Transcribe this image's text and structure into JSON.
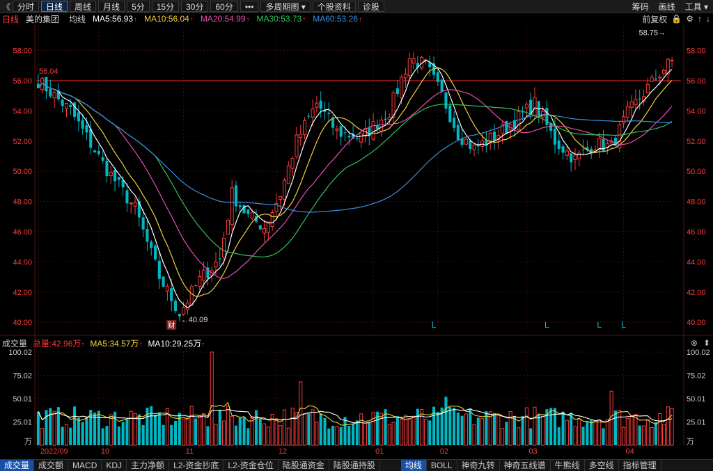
{
  "toolbar": {
    "back_icon": "《",
    "buttons": [
      "分时",
      "日线",
      "周线",
      "月线",
      "5分",
      "15分",
      "30分",
      "60分",
      "•••",
      "多周期图 ▾",
      "个股资料",
      "诊股"
    ],
    "active_index": 1,
    "right": [
      "筹码",
      "画线",
      "工具 ▾"
    ]
  },
  "legend": {
    "period": "日线",
    "stock": "美的集团",
    "ind": "均线",
    "ma5": "MA5:56.93",
    "ma10": "MA10:56.04",
    "ma20": "MA20:54.99",
    "ma30": "MA30:53.73",
    "ma60": "MA60:53.26",
    "arrow": "↑",
    "adjust": "前复权",
    "icons": [
      "🔒",
      "⚙",
      "↑",
      "↓"
    ]
  },
  "colors": {
    "up": "#ff3b3b",
    "down": "#00b7c4",
    "ma5": "#ffffff",
    "ma10": "#f2d33a",
    "ma20": "#e84fb3",
    "ma30": "#2fc45a",
    "ma60": "#3a8fe0",
    "grid": "#3a0e0e"
  },
  "chart_data": {
    "type": "candlestick",
    "y_ticks": [
      "58.00",
      "56.00",
      "54.00",
      "52.00",
      "50.00",
      "48.00",
      "46.00",
      "44.00",
      "42.00",
      "40.00"
    ],
    "ylim": [
      39.5,
      59.5
    ],
    "x_labels": [
      {
        "label": "2022/09",
        "i": 0
      },
      {
        "label": "10",
        "i": 15
      },
      {
        "label": "11",
        "i": 36
      },
      {
        "label": "12",
        "i": 59
      },
      {
        "label": "01",
        "i": 83
      },
      {
        "label": "02",
        "i": 99
      },
      {
        "label": "03",
        "i": 121
      },
      {
        "label": "04",
        "i": 145
      }
    ],
    "count": 158,
    "key_points": [
      {
        "i": 0,
        "close": 56.0
      },
      {
        "i": 8,
        "close": 54.0
      },
      {
        "i": 16,
        "close": 50.5
      },
      {
        "i": 24,
        "close": 47.5
      },
      {
        "i": 30,
        "close": 43.0
      },
      {
        "i": 35,
        "close": 40.6
      },
      {
        "i": 40,
        "close": 42.8
      },
      {
        "i": 45,
        "close": 44.2
      },
      {
        "i": 48,
        "close": 48.5
      },
      {
        "i": 52,
        "close": 47.0
      },
      {
        "i": 56,
        "close": 46.3
      },
      {
        "i": 60,
        "close": 48.5
      },
      {
        "i": 64,
        "close": 52.0
      },
      {
        "i": 69,
        "close": 54.5
      },
      {
        "i": 74,
        "close": 52.6
      },
      {
        "i": 80,
        "close": 52.2
      },
      {
        "i": 87,
        "close": 54.0
      },
      {
        "i": 92,
        "close": 57.5
      },
      {
        "i": 96,
        "close": 57.0
      },
      {
        "i": 100,
        "close": 55.0
      },
      {
        "i": 104,
        "close": 52.5
      },
      {
        "i": 108,
        "close": 51.5
      },
      {
        "i": 113,
        "close": 52.3
      },
      {
        "i": 118,
        "close": 53.3
      },
      {
        "i": 123,
        "close": 54.5
      },
      {
        "i": 128,
        "close": 52.0
      },
      {
        "i": 133,
        "close": 50.8
      },
      {
        "i": 138,
        "close": 51.8
      },
      {
        "i": 142,
        "close": 51.6
      },
      {
        "i": 146,
        "close": 53.8
      },
      {
        "i": 150,
        "close": 55.2
      },
      {
        "i": 154,
        "close": 56.5
      },
      {
        "i": 157,
        "close": 57.3
      }
    ],
    "ref_line": {
      "value": 56.0,
      "label": "56.04"
    },
    "high_label": {
      "i": 155,
      "value": 58.75,
      "label": "58.75→"
    },
    "low_label": {
      "i": 35,
      "value": 40.09,
      "label": "←40.09"
    },
    "event_marker": {
      "i": 33,
      "label": "财"
    },
    "l_markers": [
      {
        "i": 98,
        "label": "L"
      },
      {
        "i": 126,
        "label": "L"
      },
      {
        "i": 139,
        "label": "L"
      },
      {
        "i": 145,
        "label": "L"
      }
    ],
    "volume": {
      "y_ticks": [
        "100.02",
        "75.02",
        "50.01",
        "25.01",
        "万"
      ],
      "ylim": [
        0,
        100
      ],
      "spikes": [
        {
          "i": 43,
          "value": 100.0
        },
        {
          "i": 65,
          "value": 68.0
        },
        {
          "i": 142,
          "value": 58.0
        },
        {
          "i": 101,
          "value": 52.0
        }
      ]
    }
  },
  "vol_legend": {
    "title": "成交量",
    "total": "总量:42.96万",
    "ma5": "MA5:34.57万",
    "ma10": "MA10:29.25万",
    "arrow": "↑",
    "icons": [
      "⊗",
      "⬍"
    ]
  },
  "tabs": [
    "成交量",
    "成交额",
    "MACD",
    "KDJ",
    "主力净额",
    "L2-资金抄底",
    "L2-资金仓位",
    "陆股通资金",
    "陆股通持股",
    "均线",
    "BOLL",
    "神奇九转",
    "神奇五线谱",
    "牛熊线",
    "多空线",
    "指标管理"
  ],
  "active_tab": 0,
  "active_tab2": 9
}
